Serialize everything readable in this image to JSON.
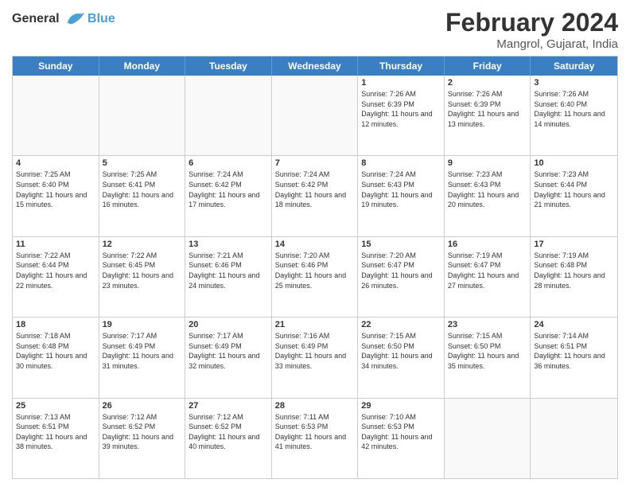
{
  "header": {
    "logo_line1": "General",
    "logo_line2": "Blue",
    "title": "February 2024",
    "subtitle": "Mangrol, Gujarat, India"
  },
  "dayHeaders": [
    "Sunday",
    "Monday",
    "Tuesday",
    "Wednesday",
    "Thursday",
    "Friday",
    "Saturday"
  ],
  "weeks": [
    [
      {
        "num": "",
        "info": "",
        "empty": true
      },
      {
        "num": "",
        "info": "",
        "empty": true
      },
      {
        "num": "",
        "info": "",
        "empty": true
      },
      {
        "num": "",
        "info": "",
        "empty": true
      },
      {
        "num": "1",
        "info": "Sunrise: 7:26 AM\nSunset: 6:39 PM\nDaylight: 11 hours and 12 minutes."
      },
      {
        "num": "2",
        "info": "Sunrise: 7:26 AM\nSunset: 6:39 PM\nDaylight: 11 hours and 13 minutes."
      },
      {
        "num": "3",
        "info": "Sunrise: 7:26 AM\nSunset: 6:40 PM\nDaylight: 11 hours and 14 minutes."
      }
    ],
    [
      {
        "num": "4",
        "info": "Sunrise: 7:25 AM\nSunset: 6:40 PM\nDaylight: 11 hours and 15 minutes."
      },
      {
        "num": "5",
        "info": "Sunrise: 7:25 AM\nSunset: 6:41 PM\nDaylight: 11 hours and 16 minutes."
      },
      {
        "num": "6",
        "info": "Sunrise: 7:24 AM\nSunset: 6:42 PM\nDaylight: 11 hours and 17 minutes."
      },
      {
        "num": "7",
        "info": "Sunrise: 7:24 AM\nSunset: 6:42 PM\nDaylight: 11 hours and 18 minutes."
      },
      {
        "num": "8",
        "info": "Sunrise: 7:24 AM\nSunset: 6:43 PM\nDaylight: 11 hours and 19 minutes."
      },
      {
        "num": "9",
        "info": "Sunrise: 7:23 AM\nSunset: 6:43 PM\nDaylight: 11 hours and 20 minutes."
      },
      {
        "num": "10",
        "info": "Sunrise: 7:23 AM\nSunset: 6:44 PM\nDaylight: 11 hours and 21 minutes."
      }
    ],
    [
      {
        "num": "11",
        "info": "Sunrise: 7:22 AM\nSunset: 6:44 PM\nDaylight: 11 hours and 22 minutes."
      },
      {
        "num": "12",
        "info": "Sunrise: 7:22 AM\nSunset: 6:45 PM\nDaylight: 11 hours and 23 minutes."
      },
      {
        "num": "13",
        "info": "Sunrise: 7:21 AM\nSunset: 6:46 PM\nDaylight: 11 hours and 24 minutes."
      },
      {
        "num": "14",
        "info": "Sunrise: 7:20 AM\nSunset: 6:46 PM\nDaylight: 11 hours and 25 minutes."
      },
      {
        "num": "15",
        "info": "Sunrise: 7:20 AM\nSunset: 6:47 PM\nDaylight: 11 hours and 26 minutes."
      },
      {
        "num": "16",
        "info": "Sunrise: 7:19 AM\nSunset: 6:47 PM\nDaylight: 11 hours and 27 minutes."
      },
      {
        "num": "17",
        "info": "Sunrise: 7:19 AM\nSunset: 6:48 PM\nDaylight: 11 hours and 28 minutes."
      }
    ],
    [
      {
        "num": "18",
        "info": "Sunrise: 7:18 AM\nSunset: 6:48 PM\nDaylight: 11 hours and 30 minutes."
      },
      {
        "num": "19",
        "info": "Sunrise: 7:17 AM\nSunset: 6:49 PM\nDaylight: 11 hours and 31 minutes."
      },
      {
        "num": "20",
        "info": "Sunrise: 7:17 AM\nSunset: 6:49 PM\nDaylight: 11 hours and 32 minutes."
      },
      {
        "num": "21",
        "info": "Sunrise: 7:16 AM\nSunset: 6:49 PM\nDaylight: 11 hours and 33 minutes."
      },
      {
        "num": "22",
        "info": "Sunrise: 7:15 AM\nSunset: 6:50 PM\nDaylight: 11 hours and 34 minutes."
      },
      {
        "num": "23",
        "info": "Sunrise: 7:15 AM\nSunset: 6:50 PM\nDaylight: 11 hours and 35 minutes."
      },
      {
        "num": "24",
        "info": "Sunrise: 7:14 AM\nSunset: 6:51 PM\nDaylight: 11 hours and 36 minutes."
      }
    ],
    [
      {
        "num": "25",
        "info": "Sunrise: 7:13 AM\nSunset: 6:51 PM\nDaylight: 11 hours and 38 minutes."
      },
      {
        "num": "26",
        "info": "Sunrise: 7:12 AM\nSunset: 6:52 PM\nDaylight: 11 hours and 39 minutes."
      },
      {
        "num": "27",
        "info": "Sunrise: 7:12 AM\nSunset: 6:52 PM\nDaylight: 11 hours and 40 minutes."
      },
      {
        "num": "28",
        "info": "Sunrise: 7:11 AM\nSunset: 6:53 PM\nDaylight: 11 hours and 41 minutes."
      },
      {
        "num": "29",
        "info": "Sunrise: 7:10 AM\nSunset: 6:53 PM\nDaylight: 11 hours and 42 minutes."
      },
      {
        "num": "",
        "info": "",
        "empty": true
      },
      {
        "num": "",
        "info": "",
        "empty": true
      }
    ]
  ]
}
